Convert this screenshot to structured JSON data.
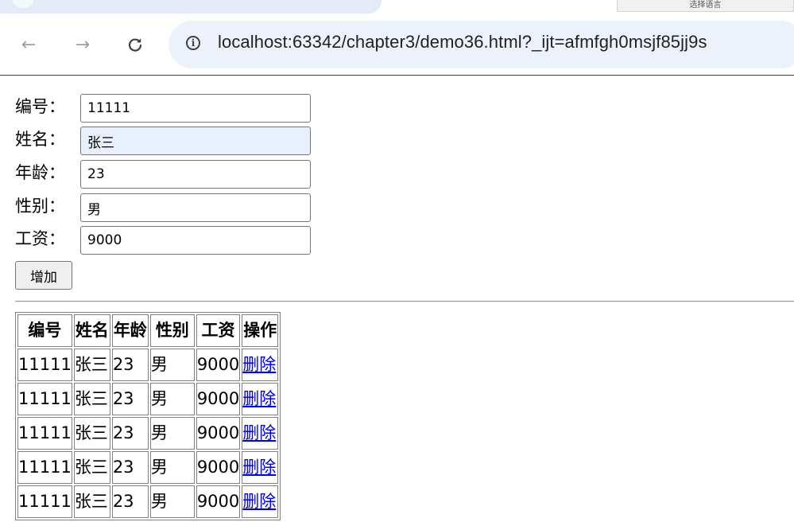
{
  "browser": {
    "translate_label": "选择语言",
    "url": "localhost:63342/chapter3/demo36.html?_ijt=afmfgh0msjf85jj9s"
  },
  "form": {
    "fields": [
      {
        "label": "编号：",
        "value": "11111"
      },
      {
        "label": "姓名：",
        "value": "张三"
      },
      {
        "label": "年龄：",
        "value": "23"
      },
      {
        "label": "性别：",
        "value": "男"
      },
      {
        "label": "工资：",
        "value": "9000"
      }
    ],
    "add_label": "增加"
  },
  "table": {
    "headers": [
      "编号",
      "姓名",
      "年龄",
      "性别",
      "工资",
      "操作"
    ],
    "rows": [
      {
        "id": "11111",
        "name": "张三",
        "age": "23",
        "sex": "男",
        "salary": "9000",
        "action": "删除"
      },
      {
        "id": "11111",
        "name": "张三",
        "age": "23",
        "sex": "男",
        "salary": "9000",
        "action": "删除"
      },
      {
        "id": "11111",
        "name": "张三",
        "age": "23",
        "sex": "男",
        "salary": "9000",
        "action": "删除"
      },
      {
        "id": "11111",
        "name": "张三",
        "age": "23",
        "sex": "男",
        "salary": "9000",
        "action": "删除"
      },
      {
        "id": "11111",
        "name": "张三",
        "age": "23",
        "sex": "男",
        "salary": "9000",
        "action": "删除"
      }
    ]
  }
}
